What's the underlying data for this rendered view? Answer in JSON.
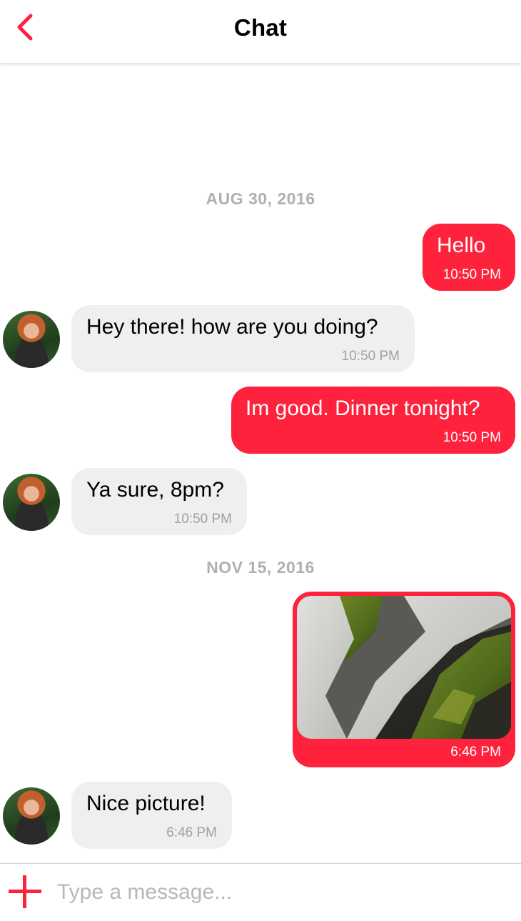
{
  "header": {
    "title": "Chat",
    "back_icon": "chevron-left-icon"
  },
  "accent_color": "#fe223d",
  "incoming_color": "#efefef",
  "date_separators": [
    "AUG 30, 2016",
    "NOV 15, 2016"
  ],
  "messages": [
    {
      "direction": "outgoing",
      "text": "Hello",
      "time": "10:50 PM"
    },
    {
      "direction": "incoming",
      "text": "Hey there! how are you doing?",
      "time": "10:50 PM"
    },
    {
      "direction": "outgoing",
      "text": "Im good. Dinner tonight?",
      "time": "10:50 PM"
    },
    {
      "direction": "incoming",
      "text": "Ya sure, 8pm?",
      "time": "10:50 PM"
    },
    {
      "direction": "outgoing",
      "type": "image",
      "image": "waterfall-photo",
      "time": "6:46 PM"
    },
    {
      "direction": "incoming",
      "text": "Nice picture!",
      "time": "6:46 PM"
    }
  ],
  "composer": {
    "placeholder": "Type a message...",
    "add_icon": "plus-icon"
  }
}
